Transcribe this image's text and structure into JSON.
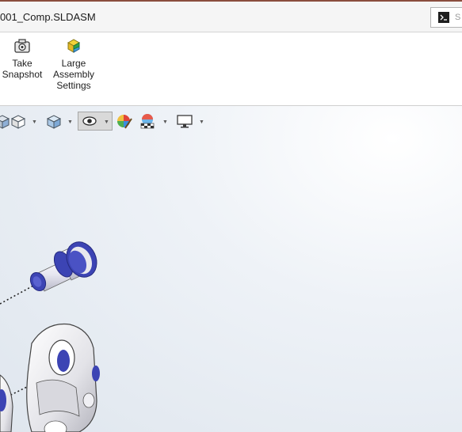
{
  "window": {
    "title": "001_Comp.SLDASM",
    "search_hint": "S"
  },
  "ribbon": {
    "buttons": [
      {
        "label_line1": "Take",
        "label_line2": "Snapshot",
        "label_line3": ""
      },
      {
        "label_line1": "Large",
        "label_line2": "Assembly",
        "label_line3": "Settings"
      }
    ]
  },
  "heads_up_toolbar": {
    "items": [
      {
        "name": "view-orientation-icon"
      },
      {
        "name": "display-style-icon"
      },
      {
        "name": "hide-show-items-icon"
      },
      {
        "name": "edit-appearance-icon"
      },
      {
        "name": "apply-scene-icon"
      },
      {
        "name": "view-settings-icon"
      }
    ]
  },
  "colors": {
    "accent_blue": "#3c44b4",
    "part_gray": "#e8e8ec",
    "title_border": "#8a4d3e"
  }
}
